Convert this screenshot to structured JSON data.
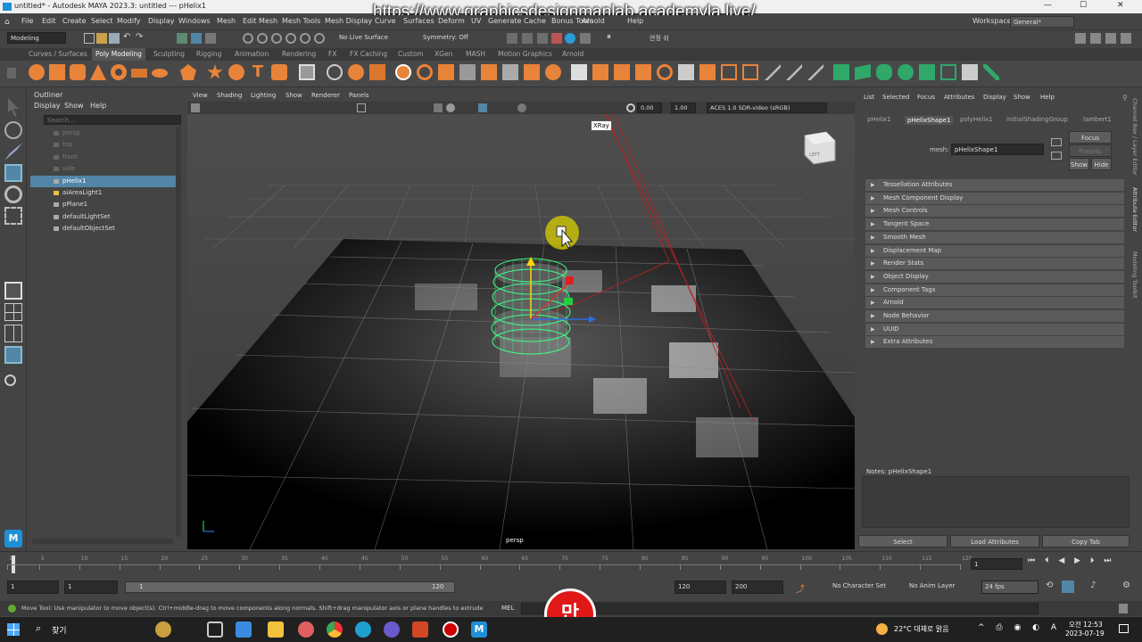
{
  "window": {
    "title": "untitled* - Autodesk MAYA 2023.3: untitled  ---  pHelix1",
    "minimize": "—",
    "maximize": "☐",
    "close": "✕"
  },
  "overlay_url": "https://www.graphicsdesignmanlab.academyla.live/",
  "menubar": {
    "items": [
      "File",
      "Edit",
      "Create",
      "Select",
      "Modify",
      "Display",
      "Windows",
      "Mesh",
      "Edit Mesh",
      "Mesh Tools",
      "Mesh Display",
      "Curve",
      "Surfaces",
      "Deform",
      "UV",
      "Generate",
      "Cache",
      "Bonus Tools",
      "Arnold",
      "Help"
    ],
    "workspace_label": "Workspace:",
    "workspace_value": "General*"
  },
  "statusline": {
    "mode": "Modeling",
    "live_surface": "No Live Surface",
    "symmetry": "Symmetry: Off",
    "user": "안정 쉬"
  },
  "shelf": {
    "tabs": [
      "Curves / Surfaces",
      "Poly Modeling",
      "Sculpting",
      "Rigging",
      "Animation",
      "Rendering",
      "FX",
      "FX Caching",
      "Custom",
      "XGen",
      "MASH",
      "Motion Graphics",
      "Arnold"
    ],
    "active_tab": "Poly Modeling"
  },
  "outliner": {
    "title": "Outliner",
    "menu": [
      "Display",
      "Show",
      "Help"
    ],
    "search_placeholder": "Search...",
    "items": [
      {
        "label": "persp",
        "dim": true,
        "selected": false,
        "icon": "camera-icon"
      },
      {
        "label": "top",
        "dim": true,
        "selected": false,
        "icon": "camera-icon"
      },
      {
        "label": "front",
        "dim": true,
        "selected": false,
        "icon": "camera-icon"
      },
      {
        "label": "side",
        "dim": true,
        "selected": false,
        "icon": "camera-icon"
      },
      {
        "label": "pHelix1",
        "dim": false,
        "selected": true,
        "icon": "mesh-icon"
      },
      {
        "label": "aiAreaLight1",
        "dim": false,
        "selected": false,
        "icon": "light-icon"
      },
      {
        "label": "pPlane1",
        "dim": false,
        "selected": false,
        "icon": "mesh-icon"
      },
      {
        "label": "defaultLightSet",
        "dim": false,
        "selected": false,
        "icon": "set-icon"
      },
      {
        "label": "defaultObjectSet",
        "dim": false,
        "selected": false,
        "icon": "set-icon"
      }
    ]
  },
  "viewport": {
    "menu": [
      "View",
      "Shading",
      "Lighting",
      "Show",
      "Renderer",
      "Panels"
    ],
    "exposure": "0.00",
    "gamma": "1.00",
    "color_space": "ACES 1.0 SDR-video (sRGB)",
    "camera_label": "persp",
    "tooltip": "XRay",
    "view_cube": "LEFT"
  },
  "attribute_editor": {
    "menu": [
      "List",
      "Selected",
      "Focus",
      "Attributes",
      "Display",
      "Show",
      "Help"
    ],
    "tabs": [
      "pHelix1",
      "pHelixShape1",
      "polyHelix1",
      "initialShadingGroup",
      "lambert1"
    ],
    "active_tab": "pHelixShape1",
    "mesh_label": "mesh:",
    "mesh_value": "pHelixShape1",
    "focus_button": "Focus",
    "presets_button": "Presets",
    "show_button": "Show",
    "hide_button": "Hide",
    "sections": [
      "Tessellation Attributes",
      "Mesh Component Display",
      "Mesh Controls",
      "Tangent Space",
      "Smooth Mesh",
      "Displacement Map",
      "Render Stats",
      "Object Display",
      "Component Tags",
      "Arnold",
      "Node Behavior",
      "UUID",
      "Extra Attributes"
    ],
    "notes_label": "Notes:  pHelixShape1",
    "select_button": "Select",
    "load_button": "Load Attributes",
    "copy_button": "Copy Tab",
    "side_tabs": [
      "Channel Box / Layer Editor",
      "Attribute Editor",
      "Modeling Toolkit"
    ]
  },
  "timeslider": {
    "ticks": [
      "1",
      "5",
      "10",
      "15",
      "20",
      "25",
      "30",
      "35",
      "40",
      "45",
      "50",
      "55",
      "60",
      "65",
      "70",
      "75",
      "80",
      "85",
      "90",
      "95",
      "100",
      "105",
      "110",
      "115",
      "120"
    ],
    "current_frame": "1"
  },
  "rangeslider": {
    "start": "1",
    "start2": "1",
    "range_start": "1",
    "range_end": "120",
    "end": "120",
    "end2": "200",
    "character_set": "No Character Set",
    "anim_layer": "No Anim Layer",
    "fps": "24 fps"
  },
  "helpline": {
    "text": "Move Tool: Use manipulator to move object(s). Ctrl+middle-drag to move components along normals. Shift+drag manipulator axis or plane handles to extrude components or c",
    "mel": "MEL"
  },
  "taskbar": {
    "search": "찾기",
    "weather": "22°C  대체로 맑음",
    "time": "오전 12:53",
    "date": "2023-07-19"
  },
  "colors": {
    "selection": "#5285a6",
    "helix": "#3dff8a",
    "maya_blue": "#1e90d6"
  }
}
